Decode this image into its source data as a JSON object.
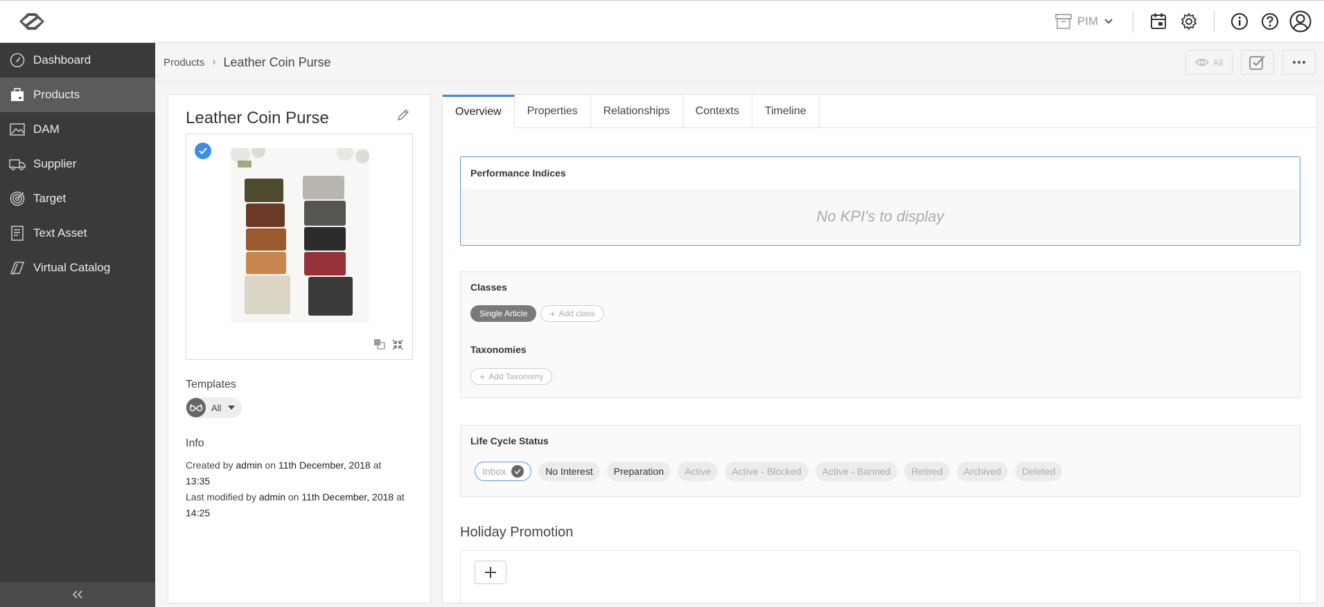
{
  "header": {
    "module": "PIM",
    "icons": [
      "logo-icon",
      "archive-icon",
      "calendar-icon",
      "gear-icon",
      "info-icon",
      "help-icon",
      "user-icon"
    ]
  },
  "sidebar": {
    "items": [
      {
        "label": "Dashboard",
        "icon": "dashboard-icon"
      },
      {
        "label": "Products",
        "icon": "products-icon"
      },
      {
        "label": "DAM",
        "icon": "image-icon"
      },
      {
        "label": "Supplier",
        "icon": "truck-icon"
      },
      {
        "label": "Target",
        "icon": "target-icon"
      },
      {
        "label": "Text Asset",
        "icon": "document-icon"
      },
      {
        "label": "Virtual Catalog",
        "icon": "catalog-icon"
      }
    ],
    "active": "Products"
  },
  "breadcrumb": {
    "parent": "Products",
    "current": "Leather Coin Purse",
    "view_filter": "All"
  },
  "product": {
    "title": "Leather Coin Purse",
    "templates_heading": "Templates",
    "template_value": "All",
    "info_heading": "Info",
    "created": {
      "prefix": "Created by",
      "user": "admin",
      "on": "on",
      "date": "11th December, 2018",
      "at": "at",
      "time": "13:35"
    },
    "modified": {
      "prefix": "Last modified by",
      "user": "admin",
      "on": "on",
      "date": "11th December, 2018",
      "at": "at",
      "time": "14:25"
    }
  },
  "tabs": [
    {
      "label": "Overview",
      "active": true
    },
    {
      "label": "Properties"
    },
    {
      "label": "Relationships"
    },
    {
      "label": "Contexts"
    },
    {
      "label": "Timeline"
    }
  ],
  "kpi": {
    "title": "Performance Indices",
    "empty": "No KPI's to display"
  },
  "classes": {
    "title": "Classes",
    "items": [
      "Single Article"
    ],
    "add_label": "Add class",
    "taxonomies_title": "Taxonomies",
    "add_taxonomy": "Add Taxonomy"
  },
  "lifecycle": {
    "title": "Life Cycle Status",
    "statuses": [
      "Inbox",
      "No Interest",
      "Preparation",
      "Active",
      "Active - Blocked",
      "Active - Banned",
      "Retired",
      "Archived",
      "Deleted"
    ],
    "selected": "Inbox"
  },
  "holiday": {
    "title": "Holiday Promotion"
  },
  "colors": {
    "sidebar": "#3a3a3a",
    "accent": "#3b8ee8"
  }
}
